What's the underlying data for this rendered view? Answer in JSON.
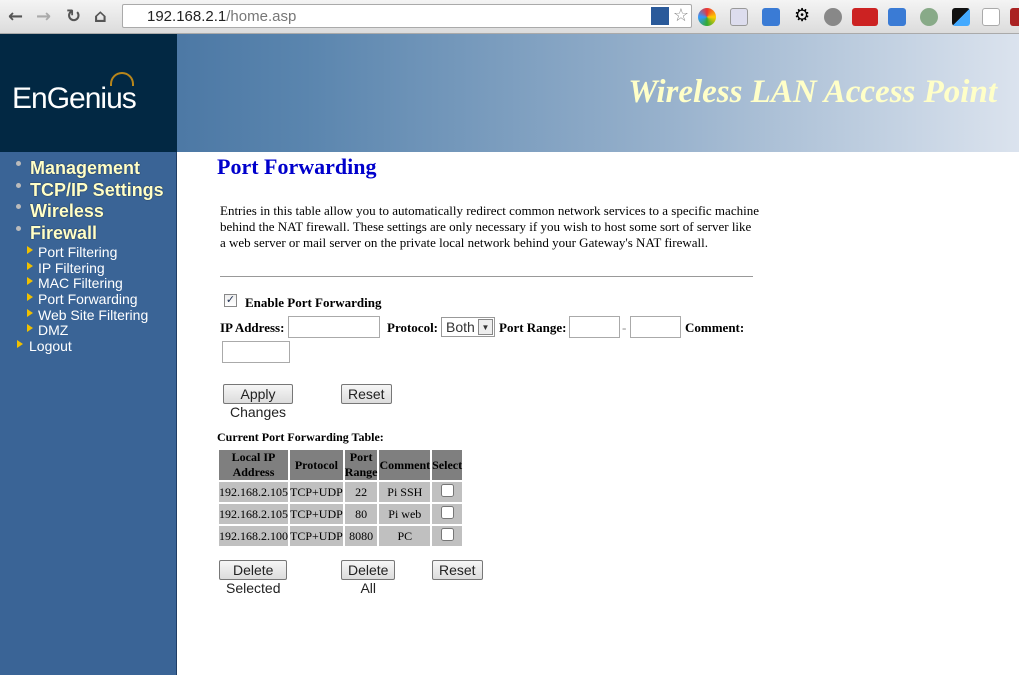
{
  "browser": {
    "url_host": "192.168.2.1",
    "url_path": "/home.asp"
  },
  "header": {
    "logo": "EnGenius",
    "banner": "Wireless LAN Access Point"
  },
  "sidebar": {
    "main": [
      "Management",
      "TCP/IP Settings",
      "Wireless",
      "Firewall"
    ],
    "sub": [
      "Port Filtering",
      "IP Filtering",
      "MAC Filtering",
      "Port Forwarding",
      "Web Site Filtering",
      "DMZ"
    ],
    "logout": "Logout"
  },
  "page": {
    "title": "Port Forwarding",
    "description": "Entries in this table allow you to automatically redirect common network services to a specific machine behind the NAT firewall. These settings are only necessary if you wish to host some sort of server like a web server or mail server on the private local network behind your Gateway's NAT firewall.",
    "enable_label": "Enable Port Forwarding",
    "enable_checked": true,
    "ip_label": "IP Address:",
    "ip_value": "",
    "protocol_label": "Protocol:",
    "protocol_value": "Both",
    "port_range_label": "Port Range:",
    "range_dash": "-",
    "port_from": "",
    "port_to": "",
    "comment_label": "Comment:",
    "comment_value": "",
    "apply": "Apply Changes",
    "reset": "Reset",
    "table_title": "Current Port Forwarding Table:",
    "columns": [
      "Local IP Address",
      "Protocol",
      "Port Range",
      "Comment",
      "Select"
    ],
    "rows": [
      [
        "192.168.2.105",
        "TCP+UDP",
        "22",
        "Pi SSH"
      ],
      [
        "192.168.2.105",
        "TCP+UDP",
        "80",
        "Pi web"
      ],
      [
        "192.168.2.100",
        "TCP+UDP",
        "8080",
        "PC"
      ]
    ],
    "delete_selected": "Delete Selected",
    "delete_all": "Delete All",
    "reset2": "Reset"
  }
}
